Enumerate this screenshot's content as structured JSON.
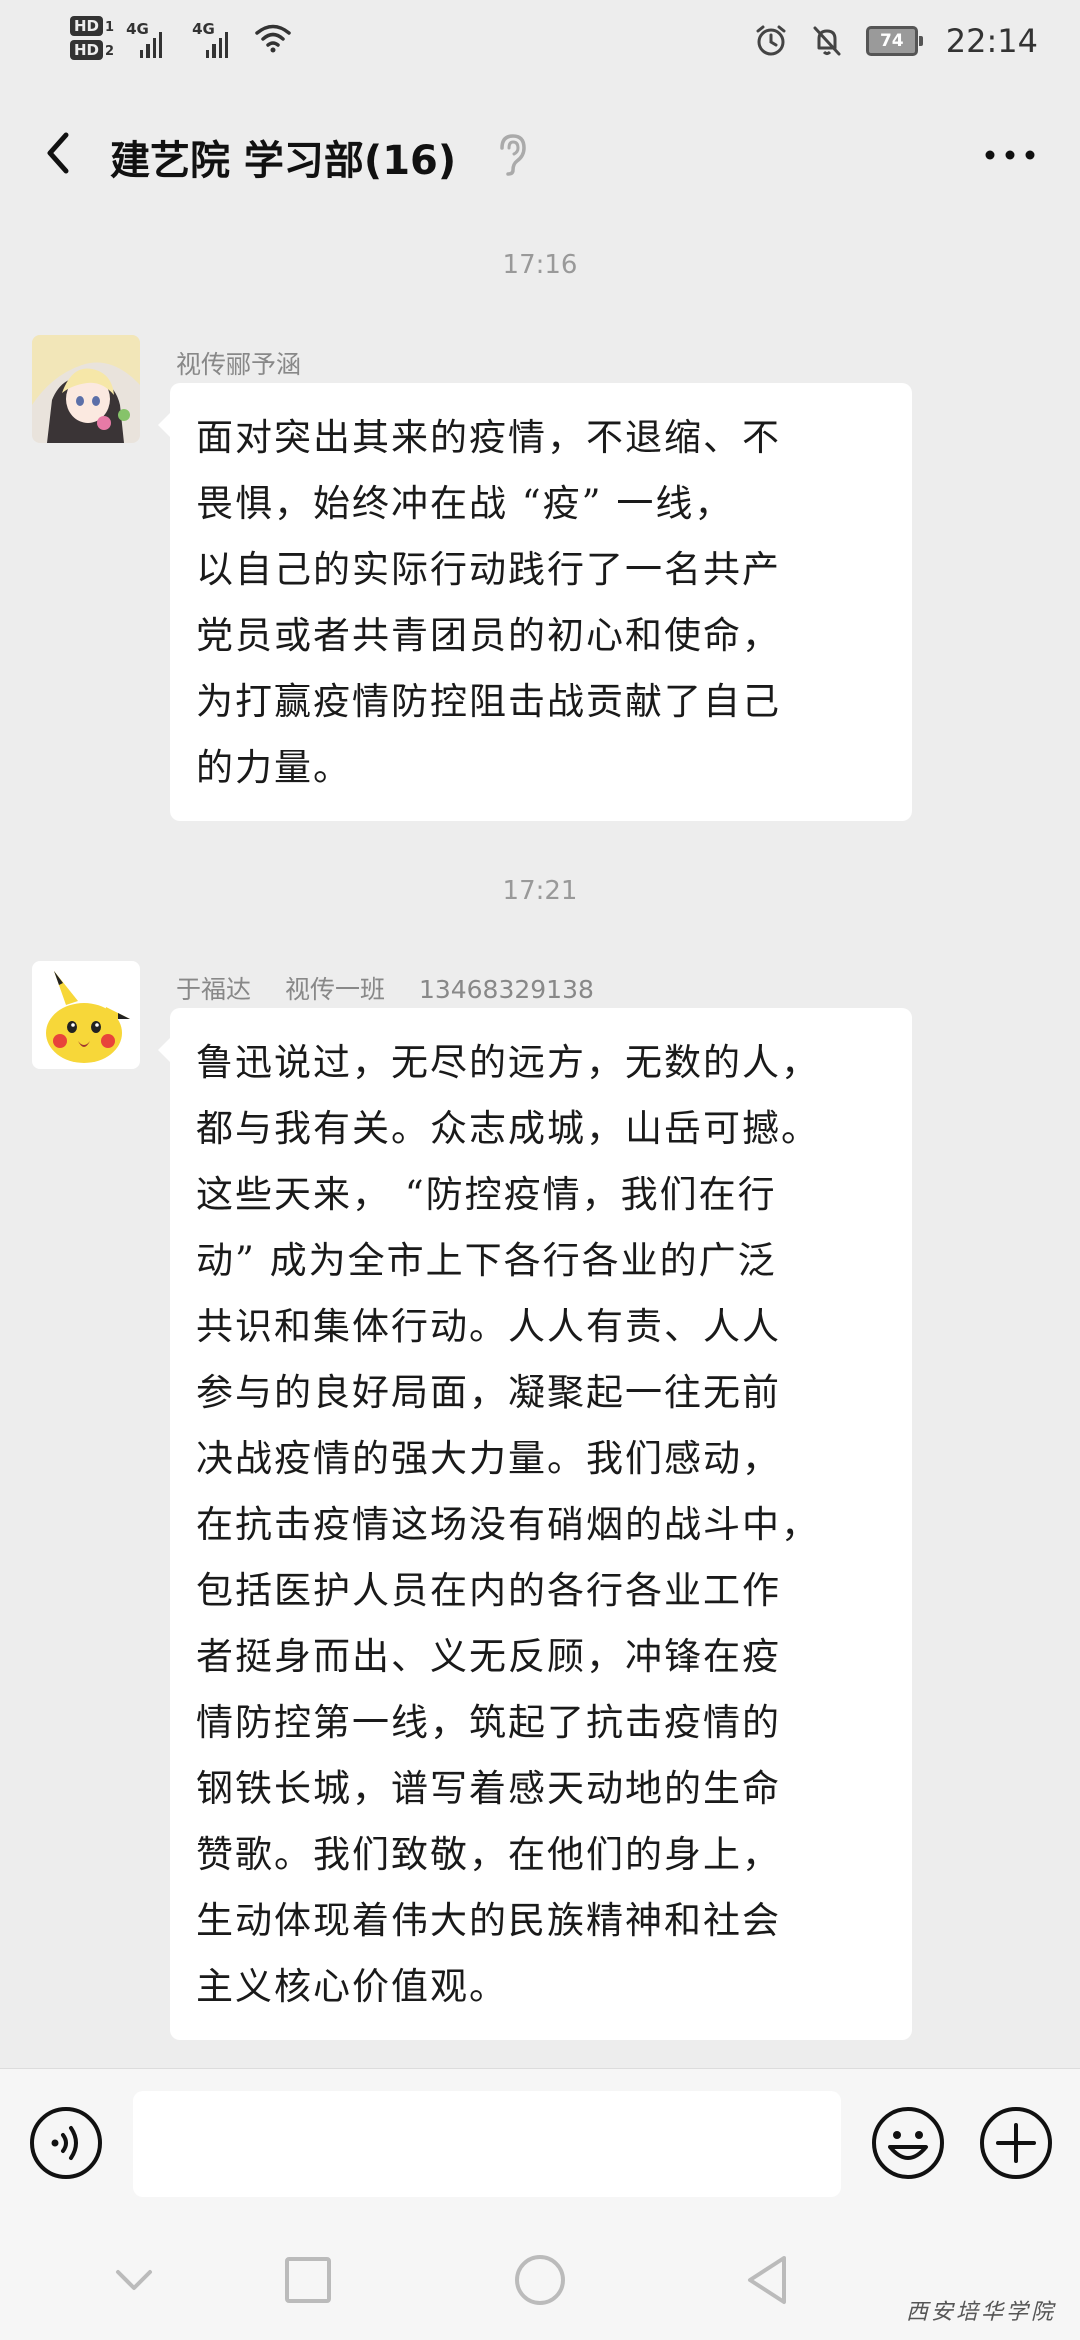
{
  "status_bar": {
    "hd1": "HD",
    "hd1_sub": "1",
    "hd2": "HD",
    "hd2_sub": "2",
    "net1": "4G",
    "net2": "4G",
    "battery": "74",
    "time": "22:14"
  },
  "header": {
    "title": "建艺院 学习部(16)"
  },
  "messages": [
    {
      "timestamp": "17:16",
      "sender": [
        "视传郦予涵"
      ],
      "lines": [
        "面对突出其来的疫情，不退缩、不",
        "畏惧，始终冲在战 “疫” 一线，",
        "以自己的实际行动践行了一名共产",
        "党员或者共青团员的初心和使命，",
        "为打赢疫情防控阻击战贡献了自己",
        "的力量。"
      ]
    },
    {
      "timestamp": "17:21",
      "sender": [
        "于福达",
        "视传一班",
        "13468329138"
      ],
      "lines": [
        "鲁迅说过，无尽的远方，无数的人，",
        "都与我有关。众志成城，山岳可撼。",
        "这些天来， “防控疫情，我们在行",
        "动” 成为全市上下各行各业的广泛",
        "共识和集体行动。人人有责、人人",
        "参与的良好局面，凝聚起一往无前",
        "决战疫情的强大力量。我们感动，",
        "在抗击疫情这场没有硝烟的战斗中，",
        "包括医护人员在内的各行各业工作",
        "者挺身而出、义无反顾，冲锋在疫",
        "情防控第一线，筑起了抗击疫情的",
        "钢铁长城，谱写着感天动地的生命",
        "赞歌。我们致敬，在他们的身上，",
        "生动体现着伟大的民族精神和社会",
        "主义核心价值观。"
      ]
    }
  ],
  "input": {
    "placeholder": ""
  },
  "watermark": "西安培华学院",
  "icons": {
    "back": "chevron-left-icon",
    "ear": "ear-icon",
    "more": "more-dots-icon",
    "voice": "voice-icon",
    "emoji": "emoji-icon",
    "plus": "plus-icon",
    "nav_down": "chevron-down-icon",
    "nav_recent": "square-icon",
    "nav_home": "circle-icon",
    "nav_back": "triangle-back-icon"
  },
  "colors": {
    "background": "#ededed",
    "bubble": "#ffffff",
    "meta_text": "#999999"
  }
}
